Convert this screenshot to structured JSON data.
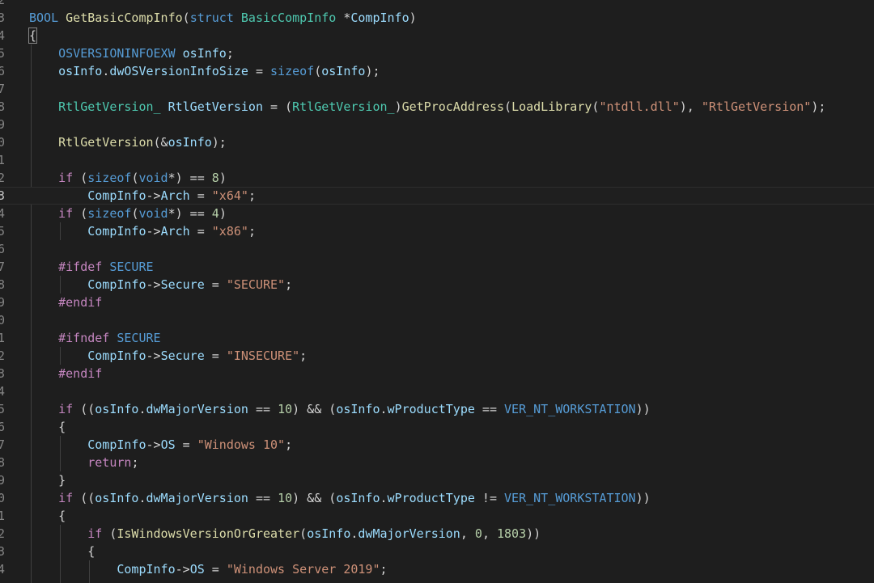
{
  "editor": {
    "line_number_digits": [
      "2",
      "3",
      "4",
      "5",
      "6",
      "7",
      "8",
      "9",
      "0",
      "1",
      "2",
      "3",
      "4",
      "5",
      "6",
      "7",
      "8",
      "9",
      "0",
      "1",
      "2",
      "3",
      "4",
      "5",
      "6",
      "7",
      "8",
      "9",
      "0",
      "1",
      "2",
      "3",
      "4"
    ],
    "current_line_index": 11,
    "lines": [
      [],
      [
        [
          "mac",
          "BOOL"
        ],
        [
          "cu",
          " "
        ],
        [
          "fn",
          "GetBasicCompInfo"
        ],
        [
          "cu",
          "("
        ],
        [
          "kw",
          "struct"
        ],
        [
          "cu",
          " "
        ],
        [
          "ty",
          "BasicCompInfo"
        ],
        [
          "cu",
          " *"
        ],
        [
          "vr",
          "CompInfo"
        ],
        [
          "cu",
          ")"
        ]
      ],
      [
        [
          "brk",
          "{"
        ]
      ],
      [
        [
          "cu",
          "    "
        ],
        [
          "mac",
          "OSVERSIONINFOEXW"
        ],
        [
          "cu",
          " "
        ],
        [
          "vr",
          "osInfo"
        ],
        [
          "cu",
          ";"
        ]
      ],
      [
        [
          "cu",
          "    "
        ],
        [
          "vr",
          "osInfo"
        ],
        [
          "cu",
          "."
        ],
        [
          "vr",
          "dwOSVersionInfoSize"
        ],
        [
          "cu",
          " = "
        ],
        [
          "kw",
          "sizeof"
        ],
        [
          "cu",
          "("
        ],
        [
          "vr",
          "osInfo"
        ],
        [
          "cu",
          ");"
        ]
      ],
      [],
      [
        [
          "cu",
          "    "
        ],
        [
          "ty",
          "RtlGetVersion_"
        ],
        [
          "cu",
          " "
        ],
        [
          "vr",
          "RtlGetVersion"
        ],
        [
          "cu",
          " = ("
        ],
        [
          "ty",
          "RtlGetVersion_"
        ],
        [
          "cu",
          ")"
        ],
        [
          "fn",
          "GetProcAddress"
        ],
        [
          "cu",
          "("
        ],
        [
          "fn",
          "LoadLibrary"
        ],
        [
          "cu",
          "("
        ],
        [
          "str",
          "\"ntdll.dll\""
        ],
        [
          "cu",
          "), "
        ],
        [
          "str",
          "\"RtlGetVersion\""
        ],
        [
          "cu",
          ");"
        ]
      ],
      [],
      [
        [
          "cu",
          "    "
        ],
        [
          "fn",
          "RtlGetVersion"
        ],
        [
          "cu",
          "(&"
        ],
        [
          "vr",
          "osInfo"
        ],
        [
          "cu",
          ");"
        ]
      ],
      [],
      [
        [
          "cu",
          "    "
        ],
        [
          "ctl",
          "if"
        ],
        [
          "cu",
          " ("
        ],
        [
          "kw",
          "sizeof"
        ],
        [
          "cu",
          "("
        ],
        [
          "kw",
          "void"
        ],
        [
          "cu",
          "*) == "
        ],
        [
          "num",
          "8"
        ],
        [
          "cu",
          ")"
        ]
      ],
      [
        [
          "cu",
          "        "
        ],
        [
          "vr",
          "CompInfo"
        ],
        [
          "cu",
          "->"
        ],
        [
          "vr",
          "Arch"
        ],
        [
          "cu",
          " = "
        ],
        [
          "str",
          "\"x64\""
        ],
        [
          "cu",
          ";"
        ]
      ],
      [
        [
          "cu",
          "    "
        ],
        [
          "ctl",
          "if"
        ],
        [
          "cu",
          " ("
        ],
        [
          "kw",
          "sizeof"
        ],
        [
          "cu",
          "("
        ],
        [
          "kw",
          "void"
        ],
        [
          "cu",
          "*) == "
        ],
        [
          "num",
          "4"
        ],
        [
          "cu",
          ")"
        ]
      ],
      [
        [
          "cu",
          "        "
        ],
        [
          "vr",
          "CompInfo"
        ],
        [
          "cu",
          "->"
        ],
        [
          "vr",
          "Arch"
        ],
        [
          "cu",
          " = "
        ],
        [
          "str",
          "\"x86\""
        ],
        [
          "cu",
          ";"
        ]
      ],
      [],
      [
        [
          "cu",
          "    "
        ],
        [
          "pp",
          "#ifdef"
        ],
        [
          "cu",
          " "
        ],
        [
          "mac",
          "SECURE"
        ]
      ],
      [
        [
          "cu",
          "        "
        ],
        [
          "vr",
          "CompInfo"
        ],
        [
          "cu",
          "->"
        ],
        [
          "vr",
          "Secure"
        ],
        [
          "cu",
          " = "
        ],
        [
          "str",
          "\"SECURE\""
        ],
        [
          "cu",
          ";"
        ]
      ],
      [
        [
          "cu",
          "    "
        ],
        [
          "pp",
          "#endif"
        ]
      ],
      [],
      [
        [
          "cu",
          "    "
        ],
        [
          "pp",
          "#ifndef"
        ],
        [
          "cu",
          " "
        ],
        [
          "mac",
          "SECURE"
        ]
      ],
      [
        [
          "cu",
          "        "
        ],
        [
          "vr",
          "CompInfo"
        ],
        [
          "cu",
          "->"
        ],
        [
          "vr",
          "Secure"
        ],
        [
          "cu",
          " = "
        ],
        [
          "str",
          "\"INSECURE\""
        ],
        [
          "cu",
          ";"
        ]
      ],
      [
        [
          "cu",
          "    "
        ],
        [
          "pp",
          "#endif"
        ]
      ],
      [],
      [
        [
          "cu",
          "    "
        ],
        [
          "ctl",
          "if"
        ],
        [
          "cu",
          " (("
        ],
        [
          "vr",
          "osInfo"
        ],
        [
          "cu",
          "."
        ],
        [
          "vr",
          "dwMajorVersion"
        ],
        [
          "cu",
          " == "
        ],
        [
          "num",
          "10"
        ],
        [
          "cu",
          ") && ("
        ],
        [
          "vr",
          "osInfo"
        ],
        [
          "cu",
          "."
        ],
        [
          "vr",
          "wProductType"
        ],
        [
          "cu",
          " == "
        ],
        [
          "mac",
          "VER_NT_WORKSTATION"
        ],
        [
          "cu",
          "))"
        ]
      ],
      [
        [
          "cu",
          "    {"
        ]
      ],
      [
        [
          "cu",
          "        "
        ],
        [
          "vr",
          "CompInfo"
        ],
        [
          "cu",
          "->"
        ],
        [
          "vr",
          "OS"
        ],
        [
          "cu",
          " = "
        ],
        [
          "str",
          "\"Windows 10\""
        ],
        [
          "cu",
          ";"
        ]
      ],
      [
        [
          "cu",
          "        "
        ],
        [
          "ctl",
          "return"
        ],
        [
          "cu",
          ";"
        ]
      ],
      [
        [
          "cu",
          "    }"
        ]
      ],
      [
        [
          "cu",
          "    "
        ],
        [
          "ctl",
          "if"
        ],
        [
          "cu",
          " (("
        ],
        [
          "vr",
          "osInfo"
        ],
        [
          "cu",
          "."
        ],
        [
          "vr",
          "dwMajorVersion"
        ],
        [
          "cu",
          " == "
        ],
        [
          "num",
          "10"
        ],
        [
          "cu",
          ") && ("
        ],
        [
          "vr",
          "osInfo"
        ],
        [
          "cu",
          "."
        ],
        [
          "vr",
          "wProductType"
        ],
        [
          "cu",
          " != "
        ],
        [
          "mac",
          "VER_NT_WORKSTATION"
        ],
        [
          "cu",
          "))"
        ]
      ],
      [
        [
          "cu",
          "    {"
        ]
      ],
      [
        [
          "cu",
          "        "
        ],
        [
          "ctl",
          "if"
        ],
        [
          "cu",
          " ("
        ],
        [
          "fn",
          "IsWindowsVersionOrGreater"
        ],
        [
          "cu",
          "("
        ],
        [
          "vr",
          "osInfo"
        ],
        [
          "cu",
          "."
        ],
        [
          "vr",
          "dwMajorVersion"
        ],
        [
          "cu",
          ", "
        ],
        [
          "num",
          "0"
        ],
        [
          "cu",
          ", "
        ],
        [
          "num",
          "1803"
        ],
        [
          "cu",
          "))"
        ]
      ],
      [
        [
          "cu",
          "        {"
        ]
      ],
      [
        [
          "cu",
          "            "
        ],
        [
          "vr",
          "CompInfo"
        ],
        [
          "cu",
          "->"
        ],
        [
          "vr",
          "OS"
        ],
        [
          "cu",
          " = "
        ],
        [
          "str",
          "\"Windows Server 2019\""
        ],
        [
          "cu",
          ";"
        ]
      ]
    ]
  }
}
